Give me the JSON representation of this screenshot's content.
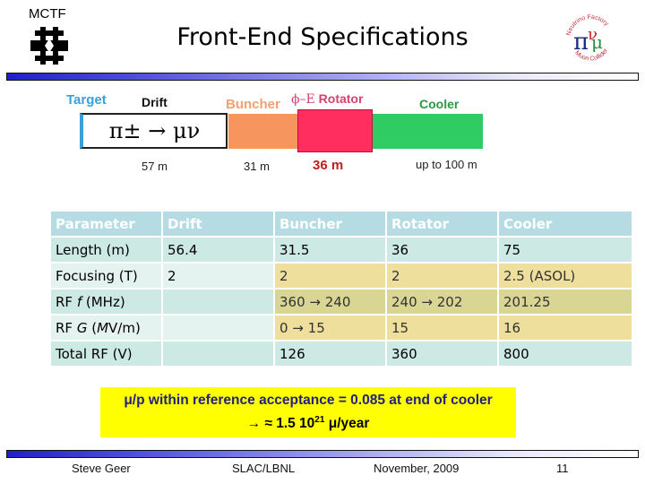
{
  "header": {
    "org_label": "MCTF",
    "title": "Front-End Specifications",
    "left_logo": "fermilab-logo",
    "right_logo": "neutrino-factory-muon-collider-logo",
    "right_logo_text_top": "Neutrino Factory",
    "right_logo_text_bottom": "Muon Collider"
  },
  "diagram": {
    "sections": [
      {
        "name": "Target",
        "color": "#3aa0d8"
      },
      {
        "name": "Drift",
        "length": "57 m",
        "inner_text": "π± → μν",
        "color": "#ffffff"
      },
      {
        "name": "Buncher",
        "length": "31 m",
        "color": "#f7955e"
      },
      {
        "name_prefix": "ϕ–E",
        "name": "Rotator",
        "length": "36 m",
        "color": "#ff2e5e"
      },
      {
        "name": "Cooler",
        "length": "up to 100 m",
        "color": "#2fcc64"
      }
    ]
  },
  "table": {
    "headers": [
      "Parameter",
      "Drift",
      "Buncher",
      "Rotator",
      "Cooler"
    ],
    "rows": [
      [
        "Length (m)",
        "56.4",
        "31.5",
        "36",
        "75"
      ],
      [
        "Focusing (T)",
        "2",
        "2",
        "2",
        "2.5 (ASOL)"
      ],
      [
        "RF f (MHz)",
        "",
        "360 → 240",
        "240 → 202",
        "201.25"
      ],
      [
        "RF G (MV/m)",
        "",
        "0 → 15",
        "15",
        "16"
      ],
      [
        "Total RF (V)",
        "",
        "126",
        "360",
        "800"
      ]
    ],
    "header_color": "#b4dce2",
    "highlight_color": "#eedf9c"
  },
  "note": {
    "line1": "μ/p within reference acceptance = 0.085 at end of cooler",
    "line2_prefix": "→ ≈ 1.5 10",
    "line2_exp": "21",
    "line2_suffix": " μ/year",
    "background": "#ffff00"
  },
  "footer": {
    "author": "Steve Geer",
    "venue": "SLAC/LBNL",
    "date": "November, 2009",
    "page": "11"
  }
}
